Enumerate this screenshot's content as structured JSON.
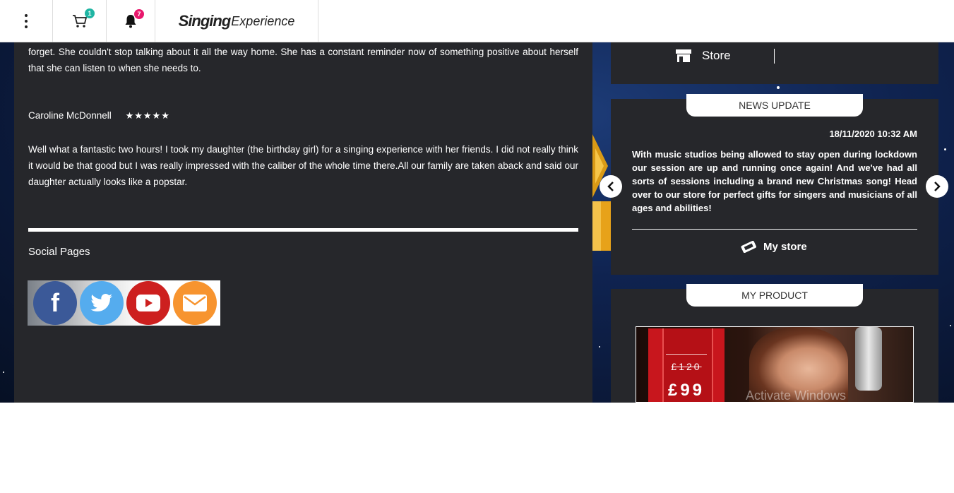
{
  "header": {
    "cart_count": "1",
    "notification_count": "7",
    "logo_text_bold": "Singing",
    "logo_text_regular": "Experience"
  },
  "reviews": {
    "partial_text": "forget. She couldn't stop talking about it all the way home. She has a constant reminder now of something positive about herself that she can listen to when she needs to.",
    "reviewer_name": "Caroline McDonnell",
    "rating_stars": "★★★★★",
    "review_text": "Well what a fantastic two hours! I took my daughter (the birthday girl) for a singing experience with her friends. I did not really think it would be that good but I was really impressed with the caliber of the whole time there.All our family are taken aback and said our daughter actually looks like a popstar."
  },
  "social": {
    "heading": "Social Pages",
    "icons": [
      "facebook-icon",
      "twitter-icon",
      "youtube-icon",
      "email-icon"
    ],
    "colors": {
      "facebook": "#3b5998",
      "twitter": "#55acee",
      "youtube": "#cd201f",
      "email": "#f7942f"
    }
  },
  "store": {
    "label": "Store"
  },
  "news": {
    "tab_label": "NEWS UPDATE",
    "date": "18/11/2020 10:32 AM",
    "body": "With music studios being allowed to stay open during lockdown our session are up and running once again! And we've had all sorts of sessions including a brand new Christmas song! Head over to our store for perfect gifts for singers and musicians of all ages and abilities!",
    "link_label": "My store"
  },
  "product": {
    "tab_label": "MY PRODUCT",
    "old_price": "£120",
    "price": "£99"
  },
  "watermark": "Activate Windows",
  "colors": {
    "panel": "#26272b",
    "cart_badge": "#1fb5a3",
    "bell_badge": "#e8176c"
  }
}
